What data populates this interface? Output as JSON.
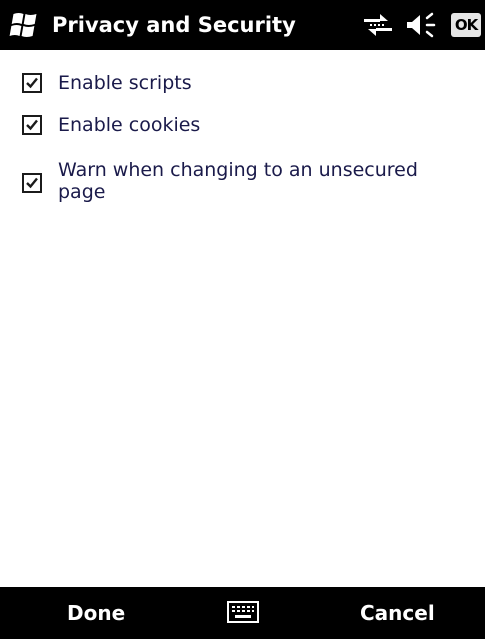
{
  "title_bar": {
    "title": "Privacy and Security",
    "ok_label": "OK",
    "icons": [
      "windows-start-icon",
      "connectivity-icon",
      "volume-icon"
    ]
  },
  "options": [
    {
      "label": "Enable scripts",
      "checked": true
    },
    {
      "label": "Enable cookies",
      "checked": true
    },
    {
      "label": "Warn when changing to an unsecured page",
      "checked": true
    }
  ],
  "menu_bar": {
    "left_label": "Done",
    "right_label": "Cancel",
    "center_icon": "keyboard-icon"
  },
  "colors": {
    "bar_background": "#000000",
    "bar_text": "#ffffff",
    "label_text": "#1a1a4a"
  }
}
